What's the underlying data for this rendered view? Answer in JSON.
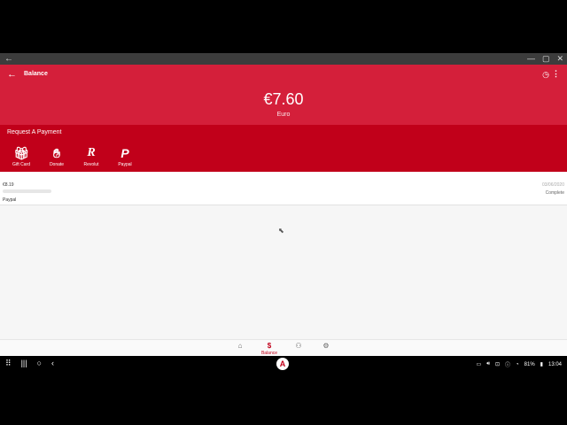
{
  "window": {
    "back_icon": "arrow-left-icon",
    "controls": [
      "minimize-icon",
      "maximize-icon",
      "close-icon"
    ]
  },
  "header": {
    "title": "Balance",
    "amount": "€7.60",
    "currency": "Euro",
    "accent": "#d41f3a"
  },
  "request": {
    "heading": "Request A Payment",
    "options": [
      {
        "label": "Gift Card",
        "icon": "gift-card-icon"
      },
      {
        "label": "Donate",
        "icon": "donate-icon"
      },
      {
        "label": "Revolut",
        "icon": "revolut-icon"
      },
      {
        "label": "Paypal",
        "icon": "paypal-icon"
      }
    ],
    "color": "#c1001a"
  },
  "transactions": [
    {
      "amount": "€8.19",
      "method": "Paypal",
      "date": "03/06/2020",
      "status": "Complete"
    }
  ],
  "bottom_nav": [
    {
      "icon": "home-icon",
      "label": ""
    },
    {
      "icon": "dollar-icon",
      "label": "Balance"
    },
    {
      "icon": "people-icon",
      "label": ""
    },
    {
      "icon": "gear-icon",
      "label": ""
    }
  ],
  "status_bar": {
    "battery": "81%",
    "time": "13:04"
  }
}
